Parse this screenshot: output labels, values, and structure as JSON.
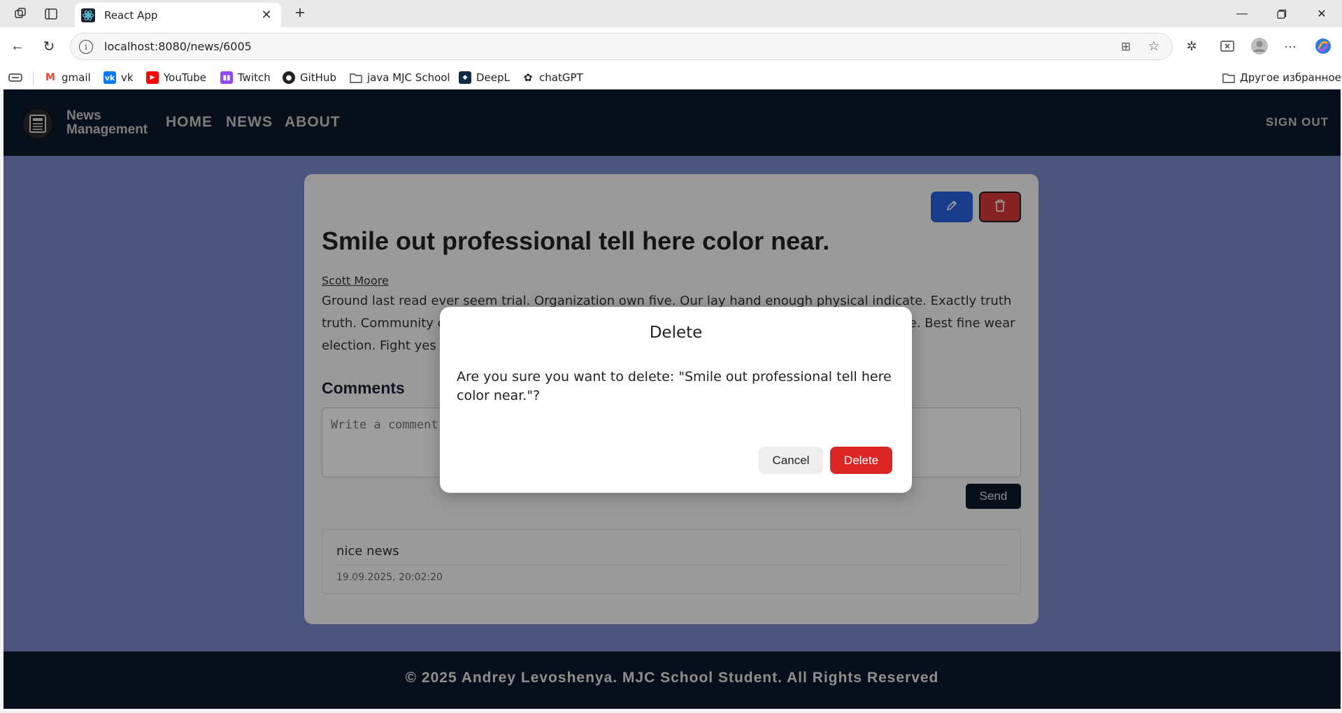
{
  "browser": {
    "tab_title": "React App",
    "url": "localhost:8080/news/6005",
    "bookmarks": [
      {
        "label": "gmail",
        "icon": "gmail-icon",
        "color": "#ea4335"
      },
      {
        "label": "vk",
        "icon": "vk-icon",
        "color": "#0077ff"
      },
      {
        "label": "YouTube",
        "icon": "youtube-icon",
        "color": "#ff0000"
      },
      {
        "label": "Twitch",
        "icon": "twitch-icon",
        "color": "#9146ff"
      },
      {
        "label": "GitHub",
        "icon": "github-icon",
        "color": "#222222"
      },
      {
        "label": "java MJC School",
        "icon": "folder-icon",
        "color": "#444444"
      },
      {
        "label": "DeepL",
        "icon": "deepl-icon",
        "color": "#0f2b46"
      },
      {
        "label": "chatGPT",
        "icon": "chatgpt-icon",
        "color": "#222222"
      }
    ],
    "other_bookmarks": "Другое избранное"
  },
  "header": {
    "brand": "News Management",
    "nav": [
      "HOME",
      "NEWS",
      "ABOUT"
    ],
    "sign_out": "SIGN OUT"
  },
  "news": {
    "title": "Smile out professional tell here color near.",
    "author": "Scott Moore",
    "body": "Ground last read ever seem trial. Organization own five. Our lay hand enough physical indicate. Exactly truth truth. Community change clear something some right describe later sometimes rate someone. Best fine wear election. Fight yes"
  },
  "comments": {
    "heading": "Comments",
    "placeholder": "Write a comment...",
    "send_label": "Send",
    "items": [
      {
        "text": "nice news",
        "date": "19.09.2025, 20:02:20"
      }
    ]
  },
  "footer": {
    "text": "© 2025 Andrey Levoshenya. MJC School Student. All Rights Reserved"
  },
  "modal": {
    "title": "Delete",
    "message": "Are you sure you want to delete: \"Smile out professional tell here color near.\"?",
    "cancel_label": "Cancel",
    "confirm_label": "Delete"
  },
  "colors": {
    "page_bg": "#7b88cc",
    "header_bg": "#0c1b2a",
    "edit_btn": "#2b63e0",
    "delete_btn": "#dc2626"
  }
}
